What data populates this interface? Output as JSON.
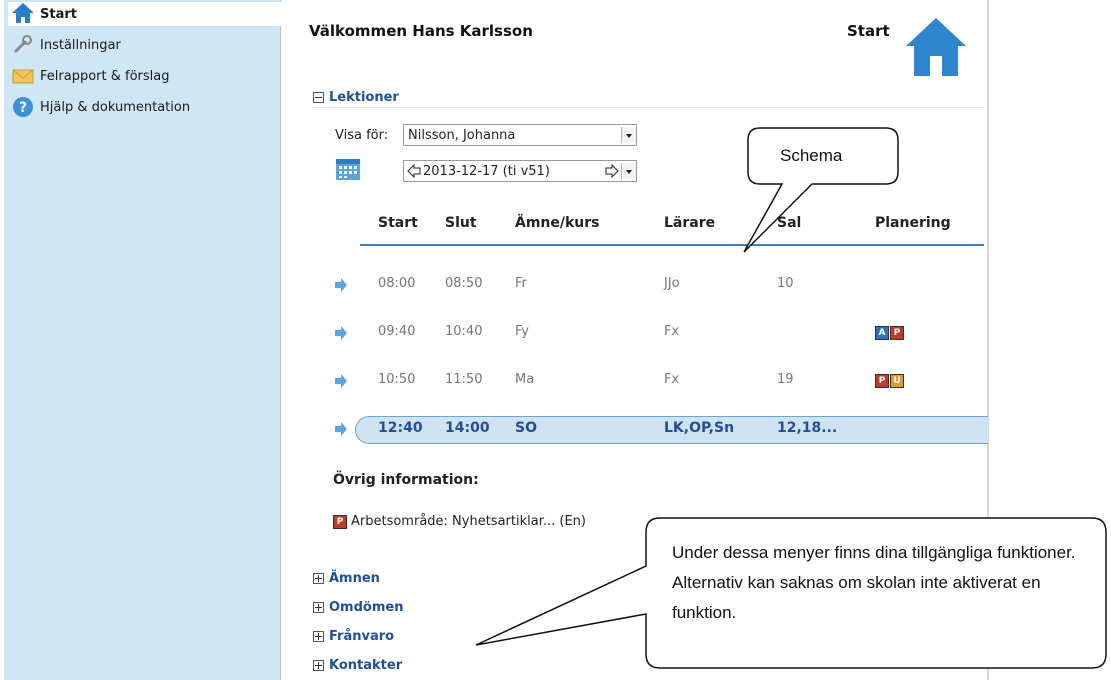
{
  "sidebar": {
    "items": [
      {
        "label": "Start",
        "icon": "home-icon"
      },
      {
        "label": "Inställningar",
        "icon": "wrench-icon"
      },
      {
        "label": "Felrapport & förslag",
        "icon": "envelope-icon"
      },
      {
        "label": "Hjälp & dokumentation",
        "icon": "help-icon"
      }
    ]
  },
  "header": {
    "welcome": "Välkommen Hans Karlsson",
    "page_label": "Start"
  },
  "lektioner": {
    "title": "Lektioner",
    "visa_label": "Visa för:",
    "visa_value": "Nilsson, Johanna",
    "date_value": "2013-12-17 (ti v51)",
    "columns": [
      "Start",
      "Slut",
      "Ämne/kurs",
      "Lärare",
      "Sal",
      "Planering"
    ],
    "rows": [
      {
        "start": "08:00",
        "slut": "08:50",
        "amne": "Fr",
        "larare": "JJo",
        "sal": "10"
      },
      {
        "start": "09:40",
        "slut": "10:40",
        "amne": "Fy",
        "larare": "Fx",
        "sal": ""
      },
      {
        "start": "10:50",
        "slut": "11:50",
        "amne": "Ma",
        "larare": "Fx",
        "sal": "19"
      },
      {
        "start": "12:40",
        "slut": "14:00",
        "amne": "SO",
        "larare": "LK,OP,Sn",
        "sal": "12,18..."
      }
    ],
    "badges": {
      "a": "A",
      "p": "P",
      "u": "U"
    },
    "other_info_title": "Övrig information:",
    "other_info_item": "Arbetsområde: Nyhetsartiklar... (En)"
  },
  "sections": [
    "Ämnen",
    "Omdömen",
    "Frånvaro",
    "Kontakter"
  ],
  "callouts": {
    "schema": "Schema",
    "menus": "Under dessa menyer finns dina tillgängliga funktioner. Alternativ kan saknas om skolan inte aktiverat en funktion."
  },
  "colors": {
    "sidebar_bg": "#cfe6f4",
    "link_blue": "#1f4e9a",
    "accent": "#2f86cf",
    "badge_blue": "#2f6fbf",
    "badge_red": "#c0392b",
    "badge_orange": "#e29a2e"
  }
}
